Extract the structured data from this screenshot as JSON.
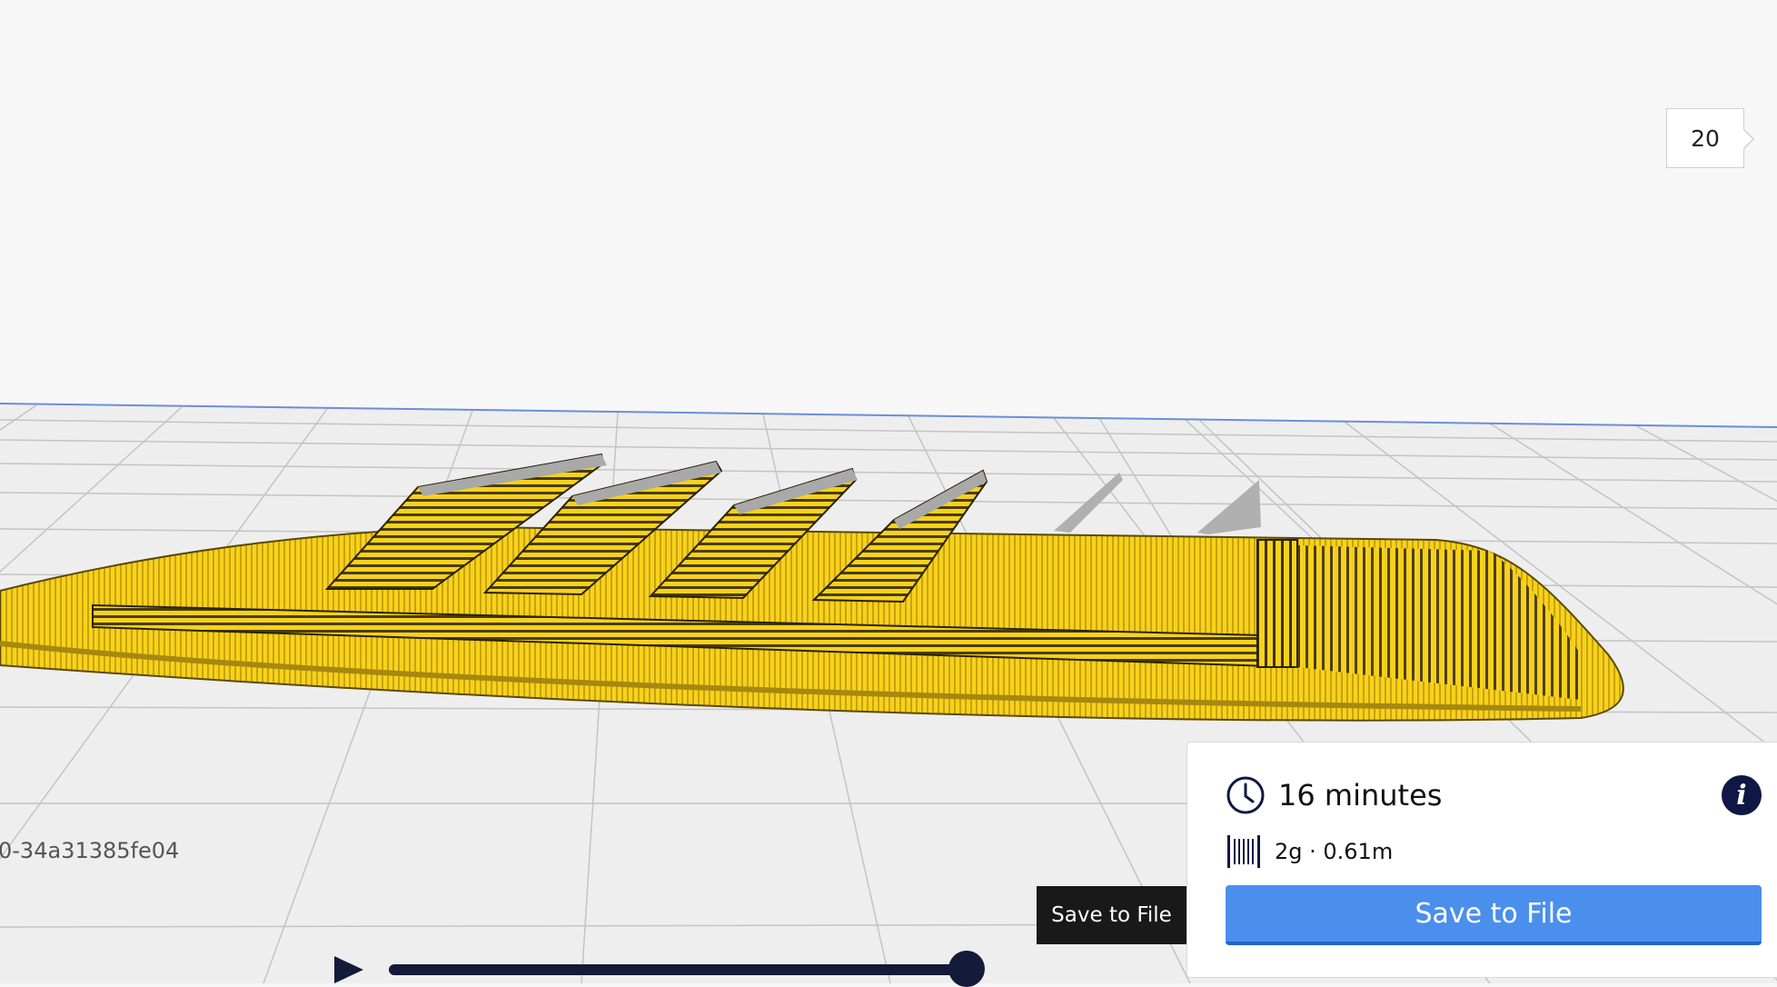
{
  "viewport": {
    "current_layer": "20",
    "model_name": "0-34a31385fe04",
    "colors": {
      "background": "#f7f7f7",
      "filament": "#f7d21c",
      "filament_shadow": "#7a6208",
      "support": "#a9a9a9",
      "grid_line": "#c9c9c9"
    }
  },
  "playback": {
    "play_icon": "play-icon",
    "progress": 1.0
  },
  "tooltip": {
    "text": "Save to File"
  },
  "print_summary": {
    "time_icon": "clock-icon",
    "print_time": "16 minutes",
    "info_icon": "info-icon",
    "material_icon": "spool-icon",
    "material": "2g · 0.61m",
    "save_label": "Save to File",
    "accent_color": "#4a8fec"
  }
}
